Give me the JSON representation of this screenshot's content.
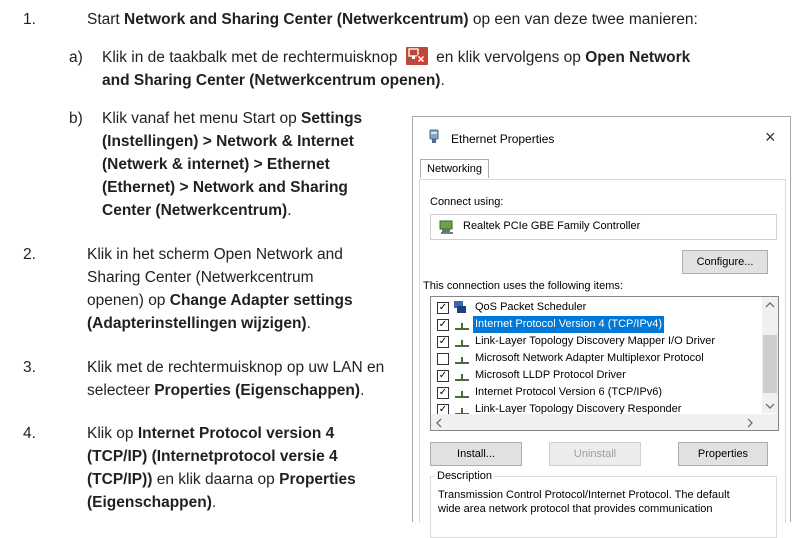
{
  "steps": {
    "s1": {
      "num": "1.",
      "line": [
        {
          "t": "Start ",
          "b": false
        },
        {
          "t": "Network and Sharing Center (Netwerkcentrum)",
          "b": true
        },
        {
          "t": " op een van deze twee manieren:",
          "b": false
        }
      ],
      "a": {
        "label": "a)",
        "pre": "Klik in de taakbalk met de rechtermuisknop",
        "post": "en klik vervolgens op",
        "bold1": "Open Network",
        "bold2": "and Sharing Center (Netwerkcentrum openen)",
        "end": "."
      },
      "b": {
        "label": "b)",
        "lines": [
          [
            {
              "t": "Klik vanaf het menu Start op ",
              "b": false
            },
            {
              "t": "Settings",
              "b": true
            }
          ],
          [
            {
              "t": "(Instellingen) > Network & Internet",
              "b": true
            }
          ],
          [
            {
              "t": "(Netwerk & internet) > Ethernet",
              "b": true
            }
          ],
          [
            {
              "t": "(Ethernet) > Network and Sharing",
              "b": true
            }
          ],
          [
            {
              "t": "Center (Netwerkcentrum)",
              "b": true
            },
            {
              "t": ".",
              "b": false
            }
          ]
        ]
      }
    },
    "s2": {
      "num": "2.",
      "lines": [
        [
          {
            "t": "Klik in het scherm Open Network and",
            "b": false
          }
        ],
        [
          {
            "t": "Sharing Center (Netwerkcentrum",
            "b": false
          }
        ],
        [
          {
            "t": "openen) op ",
            "b": false
          },
          {
            "t": "Change Adapter settings",
            "b": true
          }
        ],
        [
          {
            "t": "(Adapterinstellingen wijzigen)",
            "b": true
          },
          {
            "t": ".",
            "b": false
          }
        ]
      ]
    },
    "s3": {
      "num": "3.",
      "lines": [
        [
          {
            "t": "Klik met de rechtermuisknop op uw LAN en",
            "b": false
          }
        ],
        [
          {
            "t": "selecteer ",
            "b": false
          },
          {
            "t": "Properties (Eigenschappen)",
            "b": true
          },
          {
            "t": ".",
            "b": false
          }
        ]
      ]
    },
    "s4": {
      "num": "4.",
      "lines": [
        [
          {
            "t": "Klik op ",
            "b": false
          },
          {
            "t": "Internet Protocol version 4",
            "b": true
          }
        ],
        [
          {
            "t": "(TCP/IP) (Internetprotocol versie 4",
            "b": true
          }
        ],
        [
          {
            "t": "(TCP/IP))",
            "b": true
          },
          {
            "t": " en klik daarna op ",
            "b": false
          },
          {
            "t": "Properties",
            "b": true
          }
        ],
        [
          {
            "t": "(Eigenschappen)",
            "b": true
          },
          {
            "t": ".",
            "b": false
          }
        ]
      ]
    }
  },
  "dialog": {
    "title": "Ethernet Properties",
    "close": "×",
    "tab": "Networking",
    "connect_using": "Connect using:",
    "adapter": "Realtek PCIe GBE Family Controller",
    "configure": "Configure...",
    "items_label": "This connection uses the following items:",
    "items": [
      {
        "label": "QoS Packet Scheduler",
        "checked": true,
        "selected": false
      },
      {
        "label": "Internet Protocol Version 4 (TCP/IPv4)",
        "checked": true,
        "selected": true
      },
      {
        "label": "Link-Layer Topology Discovery Mapper I/O Driver",
        "checked": true,
        "selected": false
      },
      {
        "label": "Microsoft Network Adapter Multiplexor Protocol",
        "checked": false,
        "selected": false
      },
      {
        "label": "Microsoft LLDP Protocol Driver",
        "checked": true,
        "selected": false
      },
      {
        "label": "Internet Protocol Version 6 (TCP/IPv6)",
        "checked": true,
        "selected": false
      },
      {
        "label": "Link-Layer Topology Discovery Responder",
        "checked": true,
        "selected": false
      }
    ],
    "install": "Install...",
    "uninstall": "Uninstall",
    "properties": "Properties",
    "description_label": "Description",
    "description_line1": "Transmission Control Protocol/Internet Protocol. The default",
    "description_line2": "wide area network protocol that provides communication"
  }
}
